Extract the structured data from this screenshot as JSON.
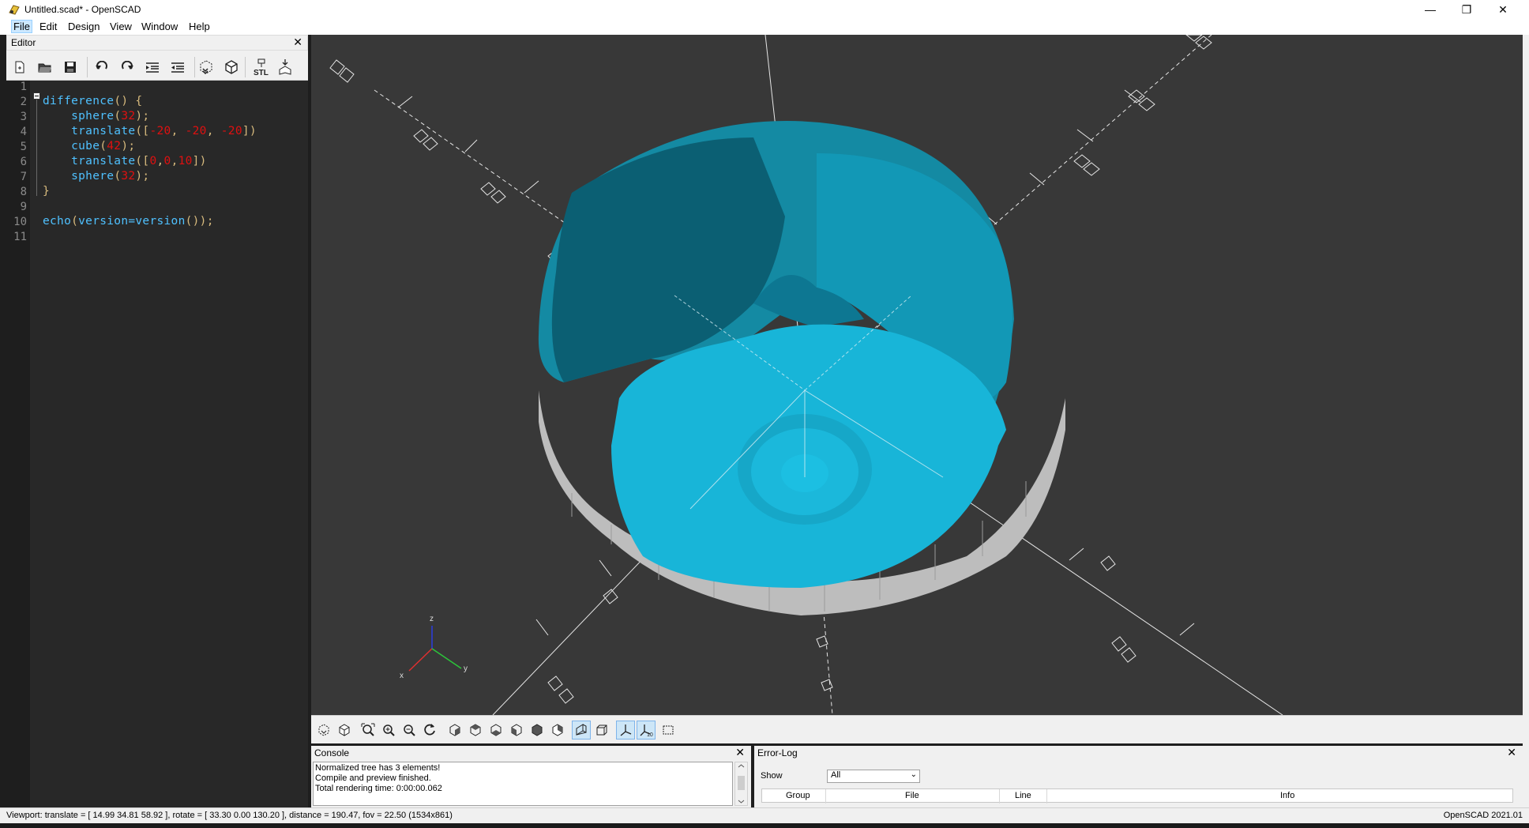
{
  "window": {
    "title": "Untitled.scad* - OpenSCAD",
    "controls": {
      "minimize": "—",
      "maximize": "❐",
      "close": "✕"
    }
  },
  "menu": [
    "File",
    "Edit",
    "Design",
    "View",
    "Window",
    "Help"
  ],
  "editor": {
    "title": "Editor",
    "close": "✕",
    "line_numbers": [
      "1",
      "2",
      "3",
      "4",
      "5",
      "6",
      "7",
      "8",
      "9",
      "10",
      "11"
    ],
    "toolbar_icons": [
      "new-file-icon",
      "open-file-icon",
      "save-icon",
      "undo-icon",
      "redo-icon",
      "indent-icon",
      "unindent-icon",
      "preview-icon",
      "render-icon",
      "export-stl-icon",
      "send-to-print-icon"
    ],
    "stl_label": "STL",
    "code": {
      "l2": "difference",
      "l2_rest": "() {",
      "l3_kw": "sphere",
      "l3_num": "32",
      "l4_kw": "translate",
      "l4_num1": "-20",
      "l4_num2": "-20",
      "l4_num3": "-20",
      "l5_kw": "cube",
      "l5_num": "42",
      "l6_kw": "translate",
      "l6_num1": "0",
      "l6_num2": "0",
      "l6_num3": "10",
      "l7_kw": "sphere",
      "l7_num": "32",
      "l8": "}",
      "l10_kw": "echo",
      "l10_arg": "version=version",
      "l10_end": "());"
    }
  },
  "viewport": {
    "axis_label_z": "z",
    "axis_label_x": "x",
    "axis_label_y": "y",
    "model_color": "#1bb8d9",
    "background": "#383838"
  },
  "view_toolbar_icons": [
    "preview-icon",
    "render-icon",
    "view-all-icon",
    "zoom-in-icon",
    "zoom-out-icon",
    "reset-view-icon",
    "view-right-icon",
    "view-top-icon",
    "view-bottom-icon",
    "view-left-icon",
    "view-front-icon",
    "view-back-icon",
    "perspective-icon",
    "orthogonal-icon",
    "show-axes-icon",
    "show-scale-markers-icon",
    "show-edges-icon"
  ],
  "console": {
    "title": "Console",
    "close": "✕",
    "lines": [
      "Normalized tree has 3 elements!",
      "Compile and preview finished.",
      "Total rendering time: 0:00:00.062"
    ]
  },
  "error_log": {
    "title": "Error-Log",
    "close": "✕",
    "show_label": "Show",
    "show_value": "All",
    "columns": [
      "Group",
      "File",
      "Line",
      "Info"
    ]
  },
  "status": {
    "viewport_info": "Viewport: translate = [ 14.99 34.81 58.92 ], rotate = [ 33.30 0.00 130.20 ], distance = 190.47, fov = 22.50 (1534x861)",
    "version": "OpenSCAD 2021.01"
  }
}
